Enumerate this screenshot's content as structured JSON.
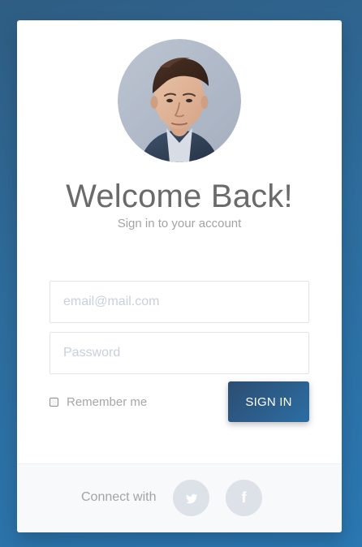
{
  "profile": {
    "title": "Welcome Back!",
    "subtitle": "Sign in to your account"
  },
  "form": {
    "email_placeholder": "email@mail.com",
    "password_placeholder": "Password",
    "remember_label": "Remember me",
    "submit_label": "SIGN IN"
  },
  "footer": {
    "connect_label": "Connect with",
    "social_icons": [
      "twitter-icon",
      "facebook-icon"
    ],
    "facebook_glyph": "f"
  },
  "colors": {
    "background_gradient_start": "#2f5d83",
    "background_gradient_end": "#2a77b2",
    "signin_gradient_start": "#2d4d71",
    "signin_gradient_end": "#2b6ea3",
    "social_button": "#dde2e8"
  }
}
